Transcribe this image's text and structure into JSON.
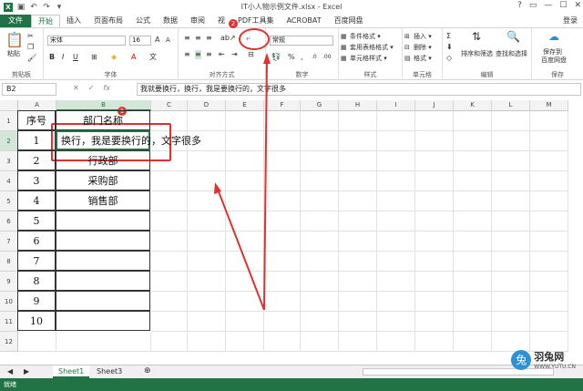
{
  "window": {
    "title": "IT小人物示例文件.xlsx - Excel",
    "login": "登录"
  },
  "tabs": [
    "文件",
    "开始",
    "插入",
    "页面布局",
    "公式",
    "数据",
    "审阅",
    "视",
    "PDF工具集",
    "ACROBAT",
    "百度网盘"
  ],
  "ribbon": {
    "clipboard": {
      "label": "剪贴板",
      "paste": "粘贴"
    },
    "font": {
      "label": "字体",
      "name": "宋体",
      "size": "16"
    },
    "alignment": {
      "label": "对齐方式"
    },
    "number": {
      "label": "数字",
      "format": "常规"
    },
    "styles": {
      "label": "样式",
      "items": [
        "条件格式 ▾",
        "套用表格格式 ▾",
        "单元格样式 ▾"
      ]
    },
    "cells": {
      "label": "单元格",
      "items": [
        "插入 ▾",
        "删除 ▾",
        "格式 ▾"
      ]
    },
    "editing": {
      "label": "编辑",
      "sort": "排序和筛选",
      "find": "查找和选择"
    },
    "save": {
      "label": "保存",
      "btn1": "保存到",
      "btn2": "百度网盘"
    }
  },
  "formula": {
    "namebox": "B2",
    "content": "我就要换行，换行，我是要换行的，文字很多"
  },
  "columns": [
    "A",
    "B",
    "C",
    "D",
    "E",
    "F",
    "G",
    "H",
    "I",
    "J",
    "K",
    "L",
    "M"
  ],
  "rows": [
    "1",
    "2",
    "3",
    "4",
    "5",
    "6",
    "7",
    "8",
    "9",
    "10",
    "11",
    "12"
  ],
  "table": {
    "header": [
      "序号",
      "部门名称"
    ],
    "b2_text": "换行，我是要换行的，文字很多",
    "rows": [
      [
        "1",
        ""
      ],
      [
        "2",
        "行政部"
      ],
      [
        "3",
        "采购部"
      ],
      [
        "4",
        "销售部"
      ],
      [
        "5",
        ""
      ],
      [
        "6",
        ""
      ],
      [
        "7",
        ""
      ],
      [
        "8",
        ""
      ],
      [
        "9",
        ""
      ],
      [
        "10",
        ""
      ]
    ]
  },
  "annotations": {
    "badge1": "1",
    "badge2": "2"
  },
  "sheets": [
    "Sheet1",
    "Sheet3"
  ],
  "status": "就绪",
  "watermark": {
    "name": "羽兔网",
    "url": "WWW.YUTU.CN"
  },
  "colors": {
    "accent": "#217346",
    "annotation": "#e03030"
  }
}
